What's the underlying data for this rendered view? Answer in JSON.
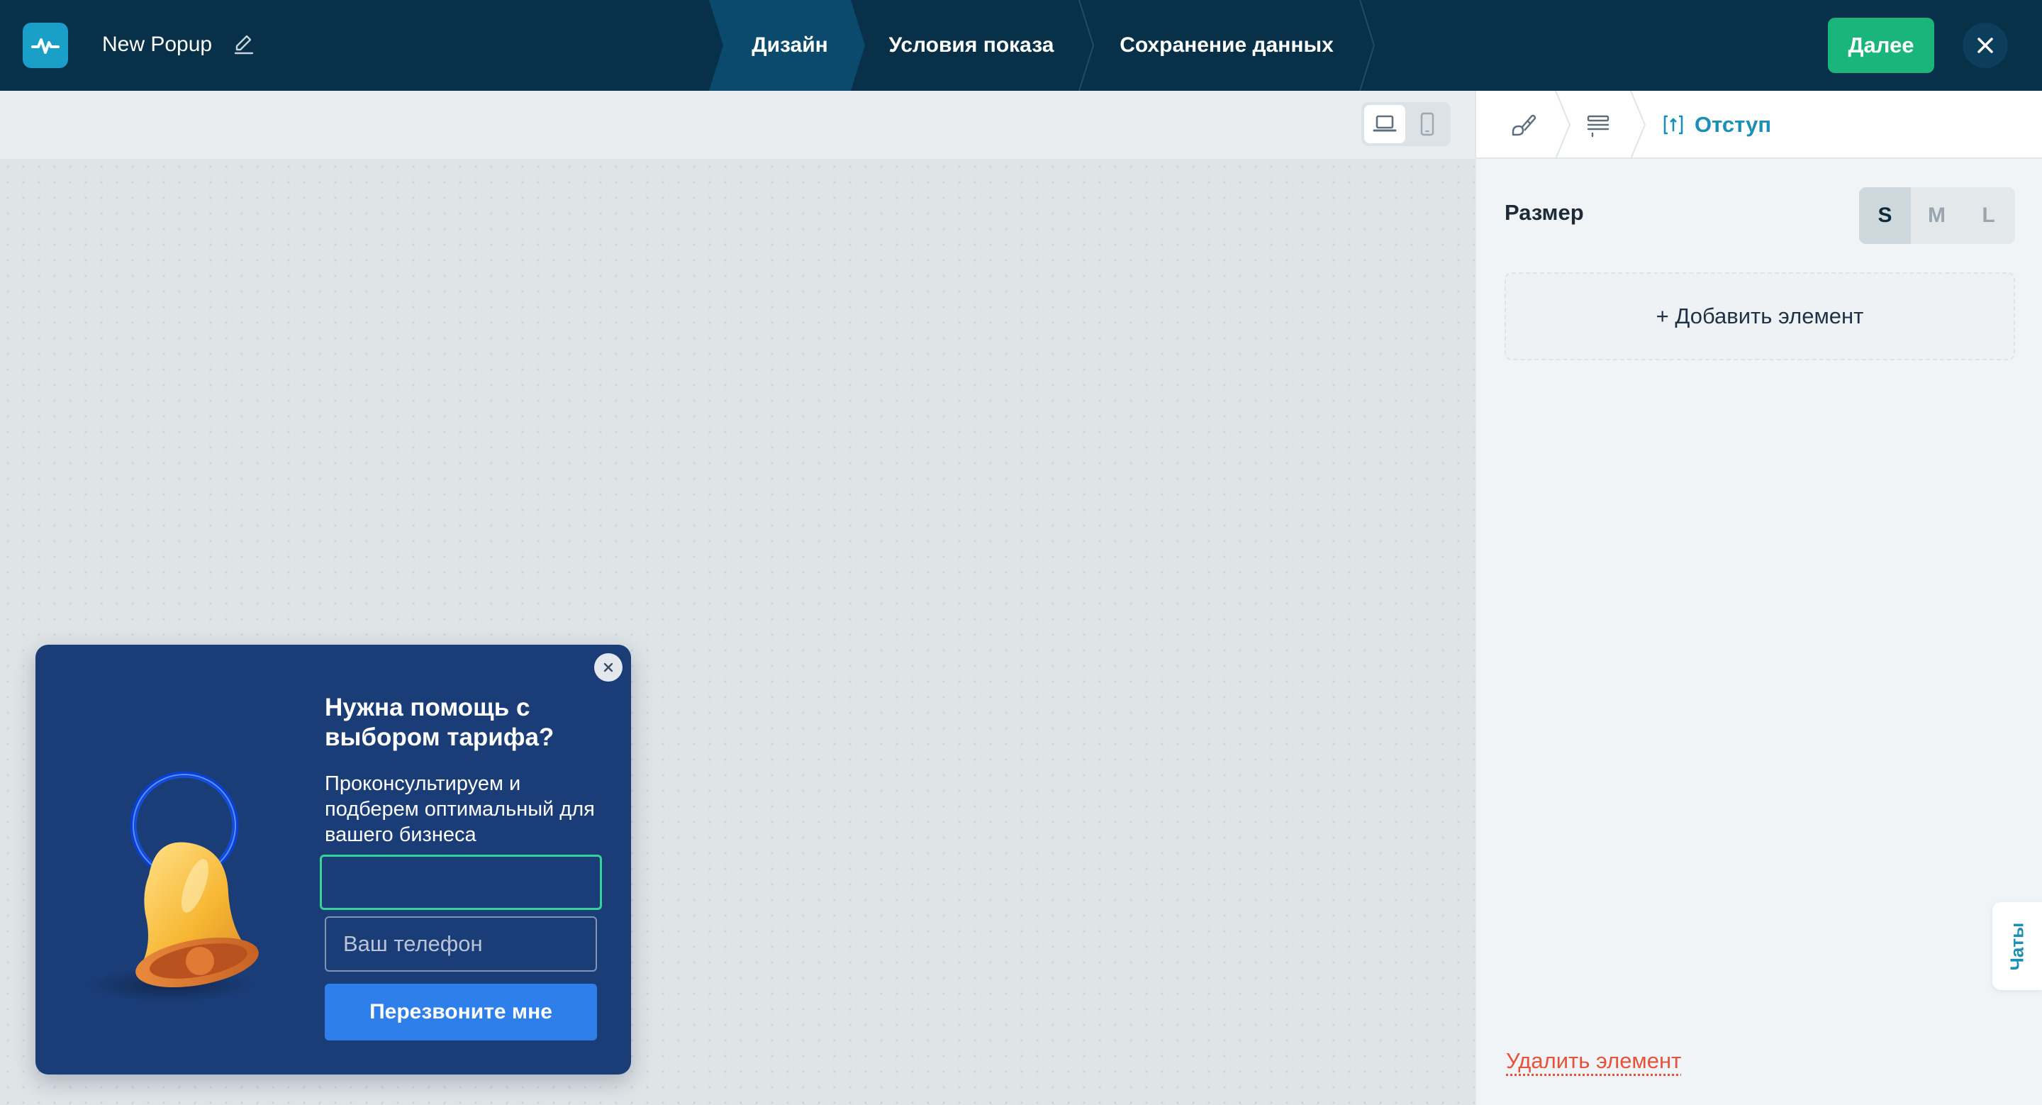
{
  "header": {
    "popup_name": "New Popup",
    "steps": [
      {
        "label": "Дизайн",
        "active": true
      },
      {
        "label": "Условия показа",
        "active": false
      },
      {
        "label": "Сохранение данных",
        "active": false
      }
    ],
    "next_label": "Далее"
  },
  "canvas": {
    "device_modes": [
      "desktop",
      "mobile"
    ],
    "selected_device": "desktop"
  },
  "popup": {
    "title": "Нужна помощь с выбором тарифа?",
    "description": "Проконсультируем и подберем оптимальный для вашего бизнеса",
    "field1_value": "",
    "phone_placeholder": "Ваш телефон",
    "submit_label": "Перезвоните мне"
  },
  "panel": {
    "breadcrumb_icons": [
      "design-icon",
      "layout-icon"
    ],
    "breadcrumb_active": "Отступ",
    "size_label": "Размер",
    "size_options": [
      "S",
      "M",
      "L"
    ],
    "size_selected": "S",
    "add_element_label": "+ Добавить элемент",
    "delete_element_label": "Удалить элемент"
  },
  "chats_label": "Чаты",
  "colors": {
    "topbar": "#083048",
    "accent_green": "#19b57a",
    "accent_teal": "#1b8fb5",
    "popup_bg": "#1a3d78",
    "popup_button": "#2f7fea",
    "danger": "#e5533b"
  }
}
